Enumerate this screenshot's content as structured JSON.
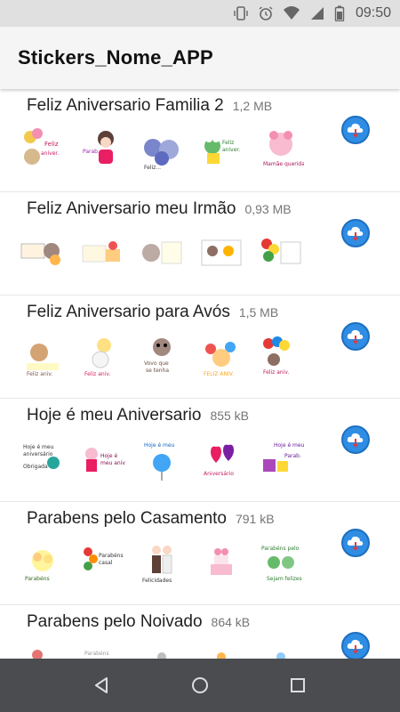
{
  "status_bar": {
    "time": "09:50",
    "icons": [
      "vibrate-icon",
      "alarm-icon",
      "wifi-icon",
      "signal-icon",
      "battery-icon"
    ]
  },
  "app_bar": {
    "title": "Stickers_Nome_APP"
  },
  "packs": [
    {
      "name": "Feliz Aniversario Familia 2",
      "size": "1,2 MB"
    },
    {
      "name": "Feliz Aniversario meu Irmão",
      "size": "0,93 MB"
    },
    {
      "name": "Feliz Aniversario para Avós",
      "size": "1,5 MB"
    },
    {
      "name": "Hoje é meu Aniversario",
      "size": "855 kB"
    },
    {
      "name": "Parabens pelo Casamento",
      "size": "791 kB"
    },
    {
      "name": "Parabens pelo Noivado",
      "size": "864 kB"
    }
  ],
  "nav_bar": {
    "icons": [
      "back-icon",
      "home-icon",
      "recents-icon"
    ]
  },
  "colors": {
    "download_button": "#2f8de4",
    "status_bar": "#e0e0e0",
    "nav_bar": "#4a4c50"
  }
}
